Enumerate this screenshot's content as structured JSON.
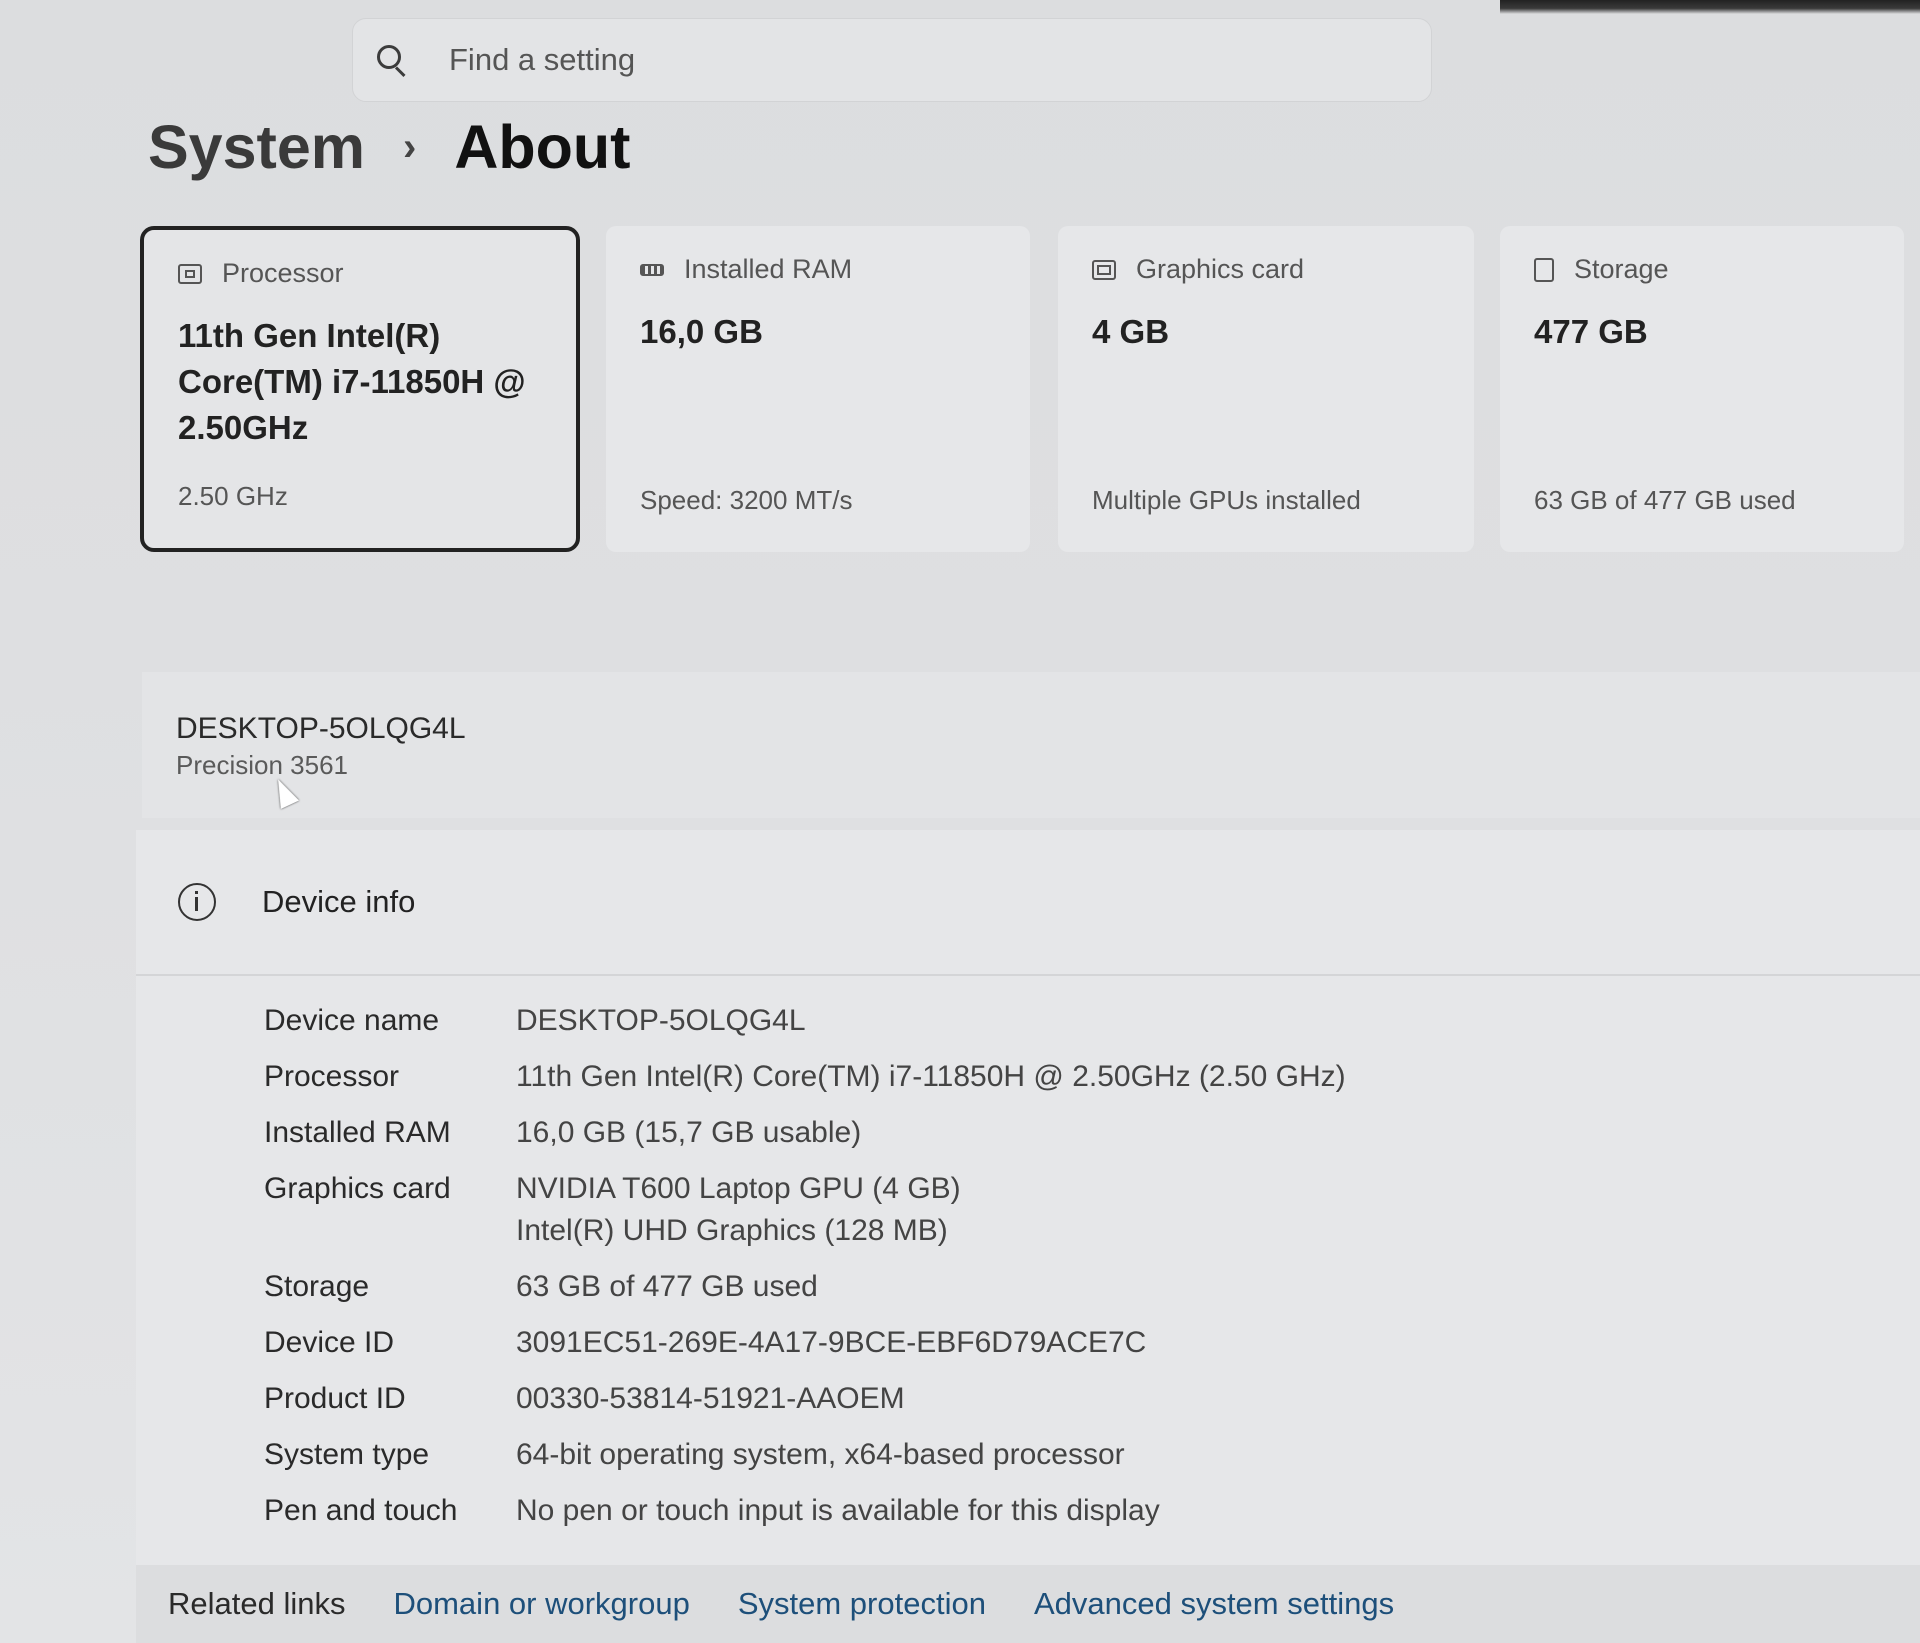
{
  "search": {
    "placeholder": "Find a setting"
  },
  "breadcrumb": {
    "parent": "System",
    "separator": "›",
    "current": "About"
  },
  "cards": [
    {
      "title": "Processor",
      "icon": "processor-icon",
      "value_lines": [
        "11th Gen Intel(R)",
        "Core(TM) i7-11850H @",
        "2.50GHz"
      ],
      "sub": "2.50 GHz"
    },
    {
      "title": "Installed RAM",
      "icon": "ram-icon",
      "value_lines": [
        "16,0 GB"
      ],
      "sub": "Speed: 3200 MT/s"
    },
    {
      "title": "Graphics card",
      "icon": "graphics-card-icon",
      "value_lines": [
        "4 GB"
      ],
      "sub": "Multiple GPUs installed"
    },
    {
      "title": "Storage",
      "icon": "storage-icon",
      "value_lines": [
        "477 GB"
      ],
      "sub": "63 GB of 477 GB used"
    }
  ],
  "device": {
    "name": "DESKTOP-5OLQG4L",
    "model": "Precision 3561"
  },
  "device_info": {
    "title": "Device info",
    "rows": [
      {
        "label": "Device name",
        "values": [
          "DESKTOP-5OLQG4L"
        ]
      },
      {
        "label": "Processor",
        "values": [
          "11th Gen Intel(R) Core(TM) i7-11850H @ 2.50GHz (2.50 GHz)"
        ]
      },
      {
        "label": "Installed RAM",
        "values": [
          "16,0 GB (15,7 GB usable)"
        ]
      },
      {
        "label": "Graphics card",
        "values": [
          "NVIDIA T600 Laptop GPU (4 GB)",
          "Intel(R) UHD Graphics (128 MB)"
        ]
      },
      {
        "label": "Storage",
        "values": [
          "63 GB of 477 GB used"
        ]
      },
      {
        "label": "Device ID",
        "values": [
          "3091EC51-269E-4A17-9BCE-EBF6D79ACE7C"
        ]
      },
      {
        "label": "Product ID",
        "values": [
          "00330-53814-51921-AAOEM"
        ]
      },
      {
        "label": "System type",
        "values": [
          "64-bit operating system, x64-based processor"
        ]
      },
      {
        "label": "Pen and touch",
        "values": [
          "No pen or touch input is available for this display"
        ]
      }
    ]
  },
  "related": {
    "label": "Related links",
    "links": [
      "Domain or workgroup",
      "System protection",
      "Advanced system settings"
    ]
  }
}
